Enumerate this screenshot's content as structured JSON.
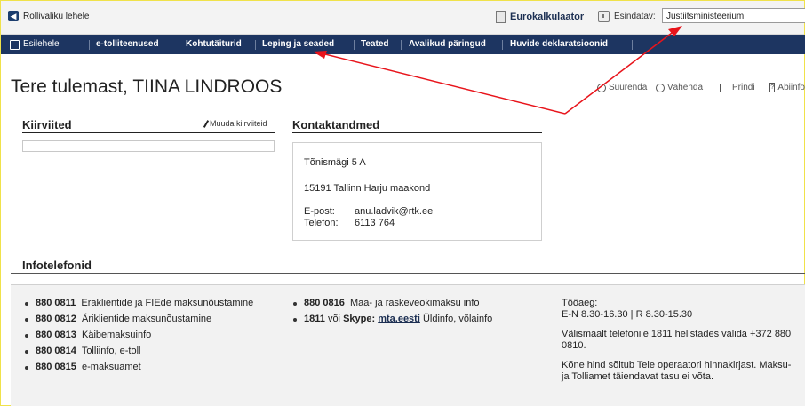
{
  "topbar": {
    "back_label": "Rollivaliku lehele",
    "calc_label": "Eurokalkulaator",
    "esindatav_label": "Esindatav:",
    "esindatav_value": "Justiitsministeerium"
  },
  "nav": {
    "items": [
      "Esilehele",
      "e-tolliteenused",
      "Kohtutäiturid",
      "Leping ja seaded",
      "Teated",
      "Avalikud päringud",
      "Huvide deklaratsioonid"
    ]
  },
  "page": {
    "title": "Tere tulemast, TIINA LINDROOS",
    "tools": [
      "Suurenda",
      "Vähenda",
      "Prindi",
      "Abiinfo"
    ]
  },
  "kiirviited": {
    "heading": "Kiirviited",
    "edit_label": "Muuda kiirviiteid"
  },
  "kontakt": {
    "heading": "Kontaktandmed",
    "street": "Tõnismägi 5 A",
    "city": "15191 Tallinn Harju maakond",
    "email_label": "E-post:",
    "email": "anu.ladvik@rtk.ee",
    "phone_label": "Telefon:",
    "phone": "6113 764"
  },
  "info": {
    "heading": "Infotelefonid",
    "col1": [
      {
        "num": "880 0811",
        "text": "Eraklientide ja FIEde maksunõustamine"
      },
      {
        "num": "880 0812",
        "text": "Äriklientide maksunõustamine"
      },
      {
        "num": "880 0813",
        "text": "Käibemaksuinfo"
      },
      {
        "num": "880 0814",
        "text": "Tolliinfo, e-toll"
      },
      {
        "num": "880 0815",
        "text": "e-maksuamet"
      }
    ],
    "col2_1_num": "880 0816",
    "col2_1_text": "Maa- ja raskeveokimaksu info",
    "col2_2_num": "1811",
    "col2_2_mid": "või",
    "col2_2_skype_label": "Skype:",
    "col2_2_skype": "mta.eesti",
    "col2_2_text": "Üldinfo, võlainfo",
    "hours_label": "Tööaeg:",
    "hours": "E-N 8.30-16.30 | R 8.30-15.30",
    "abroad": "Välismaalt telefonile 1811 helistades valida +372 880 0810.",
    "price": "Kõne hind sõltub Teie operaatori hinnakirjast. Maksu- ja Tolliamet täiendavat tasu ei võta."
  }
}
